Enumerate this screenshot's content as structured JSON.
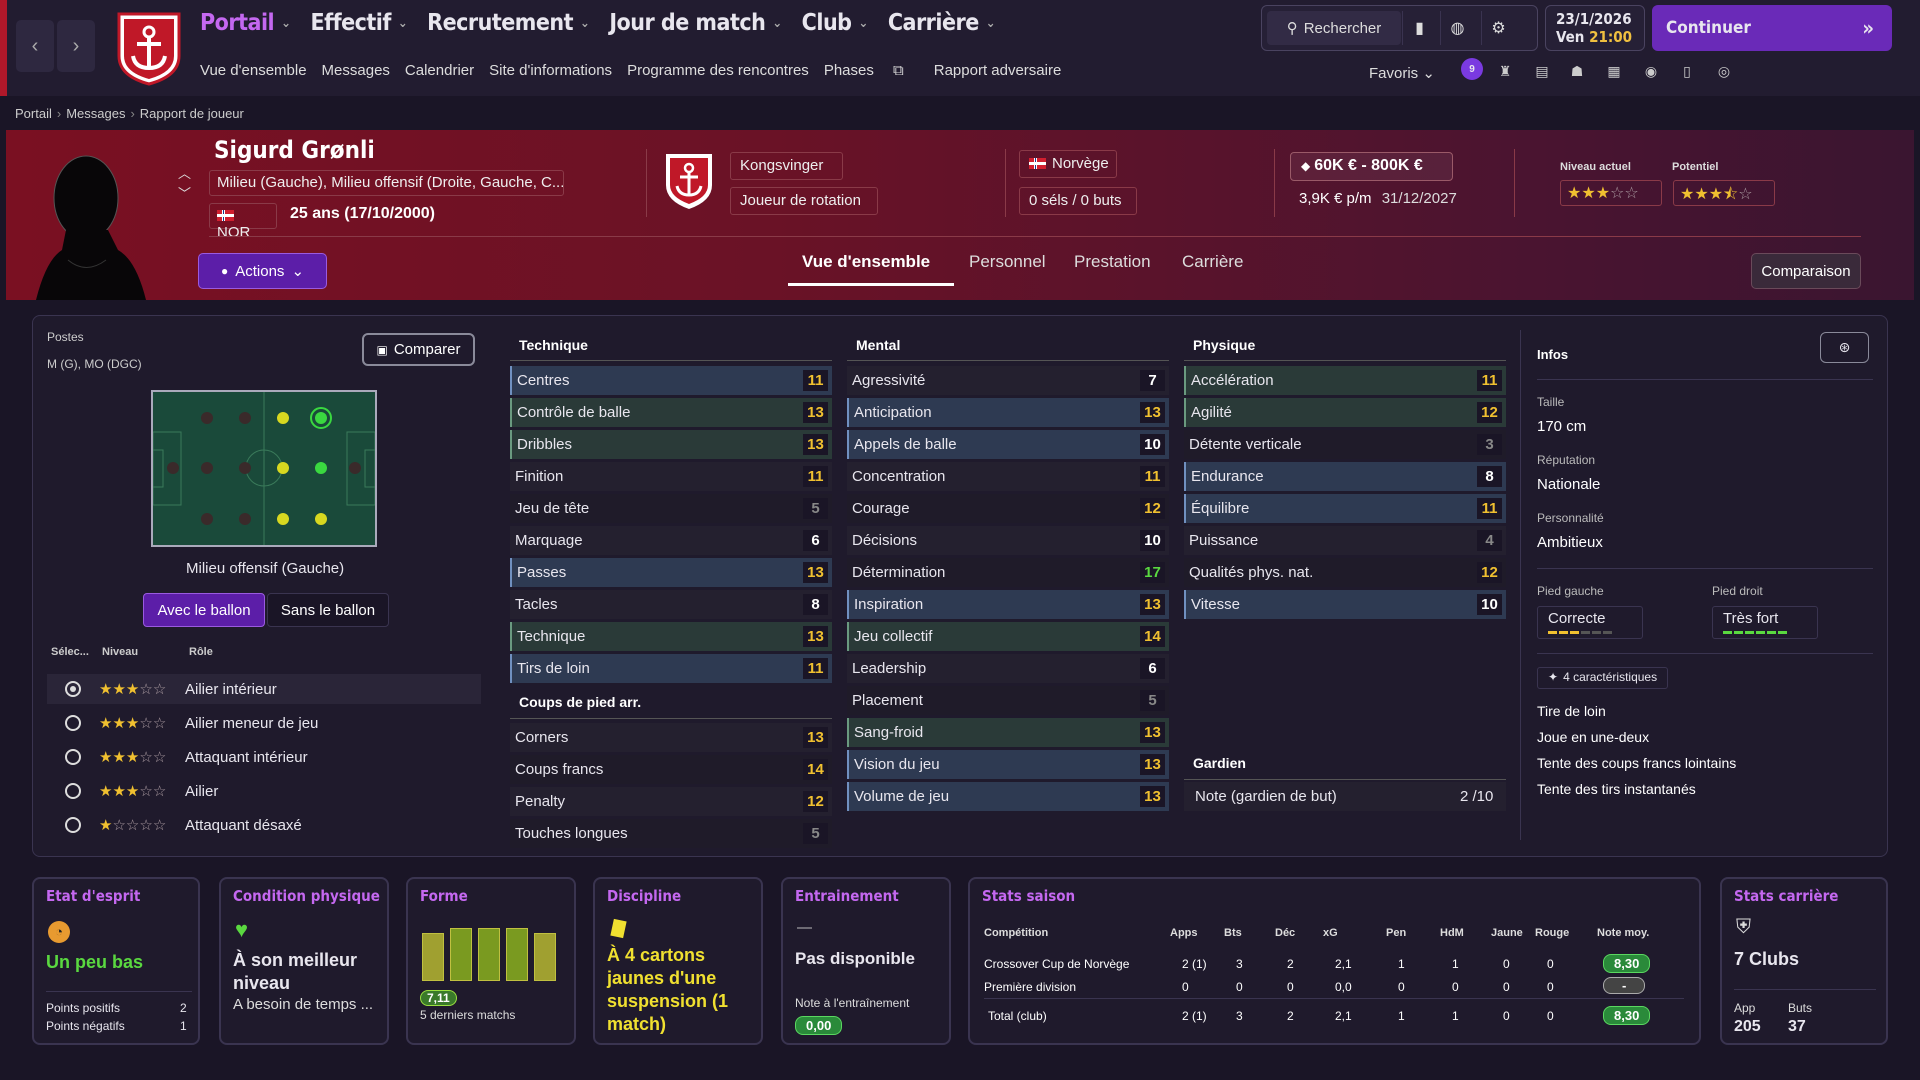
{
  "nav": {
    "main_menu": [
      "Portail",
      "Effectif",
      "Recrutement",
      "Jour de match",
      "Club",
      "Carrière"
    ],
    "active_menu": "Portail",
    "sub_menu": [
      "Vue d'ensemble",
      "Messages",
      "Calendrier",
      "Site d'informations",
      "Programme des rencontres",
      "Phases",
      "Rapport adversaire"
    ],
    "search_label": "Rechercher",
    "date": "23/1/2026",
    "day_time_prefix": "Ven",
    "time": "21:00",
    "continue_label": "Continuer",
    "favorites_label": "Favoris",
    "notifications_count": "9"
  },
  "breadcrumb": [
    "Portail",
    "Messages",
    "Rapport de joueur"
  ],
  "player": {
    "name": "Sigurd Grønli",
    "positions": "Milieu (Gauche), Milieu offensif (Droite, Gauche, C...",
    "nationality": "NOR",
    "age": "25 ans (17/10/2000)",
    "actions_label": "Actions",
    "club": "Kongsvinger",
    "squad_status": "Joueur de rotation",
    "country": "Norvège",
    "caps": "0 séls / 0 buts",
    "value": "60K € - 800K €",
    "wage": "3,9K € p/m",
    "contract_end": "31/12/2027",
    "current_level_label": "Niveau actuel",
    "potential_label": "Potentiel",
    "current_stars": 3,
    "potential_stars": 3.5
  },
  "tabs": [
    "Vue d'ensemble",
    "Personnel",
    "Prestation",
    "Carrière"
  ],
  "active_tab": "Vue d'ensemble",
  "comparison_label": "Comparaison",
  "positions_panel": {
    "title": "Postes",
    "positions": "M (G), MO (DGC)",
    "compare_label": "Comparer",
    "selected_position": "Milieu offensif (Gauche)",
    "with_ball": "Avec le ballon",
    "without_ball": "Sans le ballon",
    "headers": [
      "Sélec...",
      "Niveau",
      "Rôle"
    ],
    "roles": [
      {
        "name": "Ailier intérieur",
        "stars": 3,
        "selected": true
      },
      {
        "name": "Ailier meneur de jeu",
        "stars": 3,
        "selected": false
      },
      {
        "name": "Attaquant intérieur",
        "stars": 3,
        "selected": false
      },
      {
        "name": "Ailier",
        "stars": 3,
        "selected": false
      },
      {
        "name": "Attaquant désaxé",
        "stars": 1,
        "selected": false
      }
    ]
  },
  "technique": {
    "title": "Technique",
    "items": [
      {
        "name": "Centres",
        "value": 11,
        "hl": "hl"
      },
      {
        "name": "Contrôle de balle",
        "value": 13,
        "hl": "hl2"
      },
      {
        "name": "Dribbles",
        "value": 13,
        "hl": "hl2"
      },
      {
        "name": "Finition",
        "value": 11,
        "hl": "plain"
      },
      {
        "name": "Jeu de tête",
        "value": 5,
        "hl": "alt"
      },
      {
        "name": "Marquage",
        "value": 6,
        "hl": "plain"
      },
      {
        "name": "Passes",
        "value": 13,
        "hl": "hl"
      },
      {
        "name": "Tacles",
        "value": 8,
        "hl": "plain"
      },
      {
        "name": "Technique",
        "value": 13,
        "hl": "hl2"
      },
      {
        "name": "Tirs de loin",
        "value": 11,
        "hl": "hl"
      }
    ]
  },
  "set_pieces": {
    "title": "Coups de pied arr.",
    "items": [
      {
        "name": "Corners",
        "value": 13,
        "hl": "plain"
      },
      {
        "name": "Coups francs",
        "value": 14,
        "hl": "alt"
      },
      {
        "name": "Penalty",
        "value": 12,
        "hl": "plain"
      },
      {
        "name": "Touches longues",
        "value": 5,
        "hl": "alt"
      }
    ]
  },
  "mental": {
    "title": "Mental",
    "items": [
      {
        "name": "Agressivité",
        "value": 7,
        "hl": "plain"
      },
      {
        "name": "Anticipation",
        "value": 13,
        "hl": "hl"
      },
      {
        "name": "Appels de balle",
        "value": 10,
        "hl": "hl"
      },
      {
        "name": "Concentration",
        "value": 11,
        "hl": "plain"
      },
      {
        "name": "Courage",
        "value": 12,
        "hl": "alt"
      },
      {
        "name": "Décisions",
        "value": 10,
        "hl": "plain"
      },
      {
        "name": "Détermination",
        "value": 17,
        "hl": "alt"
      },
      {
        "name": "Inspiration",
        "value": 13,
        "hl": "hl"
      },
      {
        "name": "Jeu collectif",
        "value": 14,
        "hl": "hl2"
      },
      {
        "name": "Leadership",
        "value": 6,
        "hl": "plain"
      },
      {
        "name": "Placement",
        "value": 5,
        "hl": "alt"
      },
      {
        "name": "Sang-froid",
        "value": 13,
        "hl": "hl2"
      },
      {
        "name": "Vision du jeu",
        "value": 13,
        "hl": "hl"
      },
      {
        "name": "Volume de jeu",
        "value": 13,
        "hl": "hl"
      }
    ]
  },
  "physical": {
    "title": "Physique",
    "items": [
      {
        "name": "Accélération",
        "value": 11,
        "hl": "hl2"
      },
      {
        "name": "Agilité",
        "value": 12,
        "hl": "hl2"
      },
      {
        "name": "Détente verticale",
        "value": 3,
        "hl": "alt"
      },
      {
        "name": "Endurance",
        "value": 8,
        "hl": "hl"
      },
      {
        "name": "Équilibre",
        "value": 11,
        "hl": "hl"
      },
      {
        "name": "Puissance",
        "value": 4,
        "hl": "plain"
      },
      {
        "name": "Qualités phys. nat.",
        "value": 12,
        "hl": "alt"
      },
      {
        "name": "Vitesse",
        "value": 10,
        "hl": "hl"
      }
    ]
  },
  "goalkeeper": {
    "title": "Gardien",
    "label": "Note (gardien de but)",
    "value": "2 /10"
  },
  "info": {
    "title": "Infos",
    "height_label": "Taille",
    "height": "170 cm",
    "reputation_label": "Réputation",
    "reputation": "Nationale",
    "personality_label": "Personnalité",
    "personality": "Ambitieux",
    "left_foot_label": "Pied gauche",
    "left_foot": "Correcte",
    "left_foot_level": 3,
    "right_foot_label": "Pied droit",
    "right_foot": "Très fort",
    "right_foot_level": 6,
    "traits_label": "4 caractéristiques",
    "traits": [
      "Tire de loin",
      "Joue en une-deux",
      "Tente des coups francs lointains",
      "Tente des tirs instantanés"
    ]
  },
  "cards": {
    "morale": {
      "title": "Etat d'esprit",
      "value": "Un peu bas",
      "pos_label": "Points positifs",
      "pos": "2",
      "neg_label": "Points négatifs",
      "neg": "1"
    },
    "condition": {
      "title": "Condition physique",
      "value": "À son meilleur niveau",
      "sub": "A besoin de temps ..."
    },
    "form": {
      "title": "Forme",
      "value": "7,11",
      "sub": "5 derniers matchs",
      "bars": [
        0.8,
        0.88,
        0.88,
        0.88,
        0.8
      ]
    },
    "discipline": {
      "title": "Discipline",
      "value": "À 4 cartons jaunes d'une suspension (1 match)"
    },
    "training": {
      "title": "Entrainement",
      "dash": "—",
      "value": "Pas disponible",
      "sub": "Note à l'entraînement",
      "rating": "0,00"
    },
    "season": {
      "title": "Stats saison",
      "headers": [
        "Compétition",
        "Apps",
        "Bts",
        "Déc",
        "xG",
        "Pen",
        "HdM",
        "Jaune",
        "Rouge",
        "Note moy."
      ],
      "rows": [
        [
          "Crossover Cup de Norvège",
          "2 (1)",
          "3",
          "2",
          "2,1",
          "1",
          "1",
          "0",
          "0",
          "8,30"
        ],
        [
          "Première division",
          "0",
          "0",
          "0",
          "0,0",
          "0",
          "0",
          "0",
          "0",
          "-"
        ],
        [
          "Total (club)",
          "2 (1)",
          "3",
          "2",
          "2,1",
          "1",
          "1",
          "0",
          "0",
          "8,30"
        ]
      ]
    },
    "career": {
      "title": "Stats carrière",
      "value": "7 Clubs",
      "app_label": "App",
      "app": "205",
      "goals_label": "Buts",
      "goals": "37"
    }
  },
  "colors": {
    "accent": "#c468f0",
    "button": "#5c1ea8",
    "header_red": "#7a1022",
    "green": "#5ad840",
    "yellow": "#f0c030"
  }
}
